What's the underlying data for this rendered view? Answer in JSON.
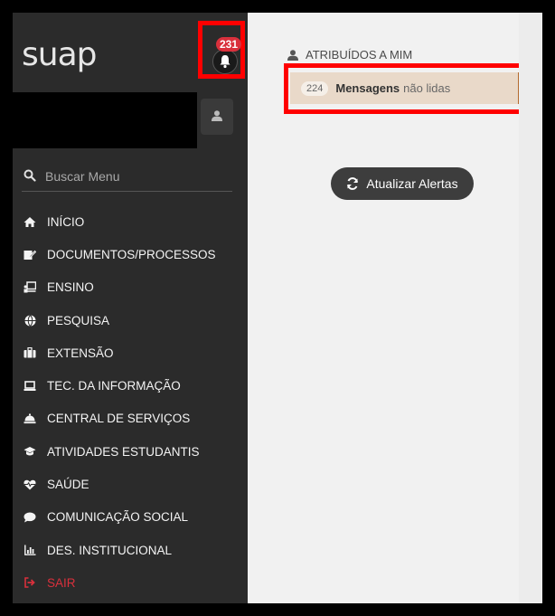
{
  "app": {
    "logo": "suap"
  },
  "notifications": {
    "count": "231"
  },
  "search": {
    "placeholder": "Buscar Menu"
  },
  "menu": {
    "items": [
      {
        "label": "INÍCIO",
        "icon": "home-icon"
      },
      {
        "label": "DOCUMENTOS/PROCESSOS",
        "icon": "document-edit-icon"
      },
      {
        "label": "ENSINO",
        "icon": "teacher-board-icon"
      },
      {
        "label": "PESQUISA",
        "icon": "globe-icon"
      },
      {
        "label": "EXTENSÃO",
        "icon": "briefcase-icon"
      },
      {
        "label": "TEC. DA INFORMAÇÃO",
        "icon": "laptop-icon"
      },
      {
        "label": "CENTRAL DE SERVIÇOS",
        "icon": "service-bell-icon"
      },
      {
        "label": "ATIVIDADES ESTUDANTIS",
        "icon": "graduation-cap-icon"
      },
      {
        "label": "SAÚDE",
        "icon": "heartbeat-icon"
      },
      {
        "label": "COMUNICAÇÃO SOCIAL",
        "icon": "chat-bubble-icon"
      },
      {
        "label": "DES. INSTITUCIONAL",
        "icon": "bar-chart-icon"
      },
      {
        "label": "SAIR",
        "icon": "sign-out-icon"
      }
    ]
  },
  "main": {
    "assigned_label": "ATRIBUÍDOS A MIM",
    "alert": {
      "count": "224",
      "strong": "Mensagens",
      "rest": "não lidas"
    },
    "refresh_label": "Atualizar Alertas"
  },
  "colors": {
    "sidebar": "#2b2b2b",
    "accent_red": "#d9303c",
    "highlight": "#ff0000",
    "alert_bg": "#e9d9c9"
  }
}
